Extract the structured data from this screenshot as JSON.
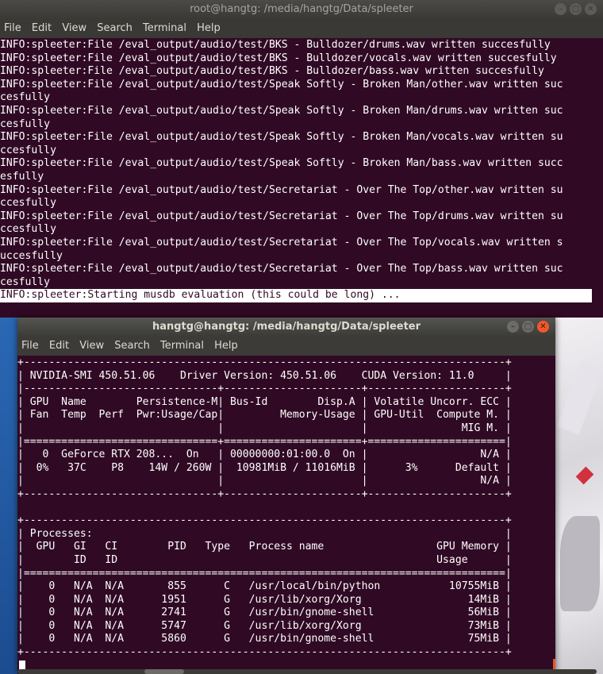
{
  "colors": {
    "terminal_bg": "#300a24",
    "titlebar": "#3c3b37",
    "text": "#ffffff",
    "close_button": "#f0582a"
  },
  "window_icons": [
    "minimize-icon",
    "maximize-icon",
    "close-icon"
  ],
  "back_terminal": {
    "title": "root@hangtg: /media/hangtg/Data/spleeter",
    "menu": [
      "File",
      "Edit",
      "View",
      "Search",
      "Terminal",
      "Help"
    ],
    "lines": [
      "INFO:spleeter:File /eval_output/audio/test/BKS - Bulldozer/drums.wav written succesfully",
      "INFO:spleeter:File /eval_output/audio/test/BKS - Bulldozer/vocals.wav written succesfully",
      "INFO:spleeter:File /eval_output/audio/test/BKS - Bulldozer/bass.wav written succesfully",
      "INFO:spleeter:File /eval_output/audio/test/Speak Softly - Broken Man/other.wav written suc",
      "cesfully",
      "INFO:spleeter:File /eval_output/audio/test/Speak Softly - Broken Man/drums.wav written suc",
      "cesfully",
      "INFO:spleeter:File /eval_output/audio/test/Speak Softly - Broken Man/vocals.wav written su",
      "ccesfully",
      "INFO:spleeter:File /eval_output/audio/test/Speak Softly - Broken Man/bass.wav written succ",
      "esfully",
      "INFO:spleeter:File /eval_output/audio/test/Secretariat - Over The Top/other.wav written su",
      "ccesfully",
      "INFO:spleeter:File /eval_output/audio/test/Secretariat - Over The Top/drums.wav written su",
      "ccesfully",
      "INFO:spleeter:File /eval_output/audio/test/Secretariat - Over The Top/vocals.wav written s",
      "uccesfully",
      "INFO:spleeter:File /eval_output/audio/test/Secretariat - Over The Top/bass.wav written suc",
      "cesfully"
    ],
    "current_line": "INFO:spleeter:Starting musdb evaluation (this could be long) ..."
  },
  "front_terminal": {
    "title": "hangtg@hangtg: /media/hangtg/Data/spleeter",
    "menu": [
      "File",
      "Edit",
      "View",
      "Search",
      "Terminal",
      "Help"
    ],
    "lines": [
      "+-----------------------------------------------------------------------------+",
      "| NVIDIA-SMI 450.51.06    Driver Version: 450.51.06    CUDA Version: 11.0     |",
      "|-------------------------------+----------------------+----------------------+",
      "| GPU  Name        Persistence-M| Bus-Id        Disp.A | Volatile Uncorr. ECC |",
      "| Fan  Temp  Perf  Pwr:Usage/Cap|         Memory-Usage | GPU-Util  Compute M. |",
      "|                               |                      |               MIG M. |",
      "|===============================+======================+======================|",
      "|   0  GeForce RTX 208...  On   | 00000000:01:00.0  On |                  N/A |",
      "|  0%   37C    P8    14W / 260W |  10981MiB / 11016MiB |      3%      Default |",
      "|                               |                      |                  N/A |",
      "+-------------------------------+----------------------+----------------------+",
      "",
      "+-----------------------------------------------------------------------------+",
      "| Processes:                                                                  |",
      "|  GPU   GI   CI        PID   Type   Process name                  GPU Memory |",
      "|        ID   ID                                                   Usage      |",
      "|=============================================================================|",
      "|    0   N/A  N/A       855      C   /usr/local/bin/python           10755MiB |",
      "|    0   N/A  N/A      1951      G   /usr/lib/xorg/Xorg                 14MiB |",
      "|    0   N/A  N/A      2741      G   /usr/bin/gnome-shell               56MiB |",
      "|    0   N/A  N/A      5747      G   /usr/lib/xorg/Xorg                 73MiB |",
      "|    0   N/A  N/A      5860      G   /usr/bin/gnome-shell               75MiB |",
      "+-----------------------------------------------------------------------------+"
    ]
  }
}
